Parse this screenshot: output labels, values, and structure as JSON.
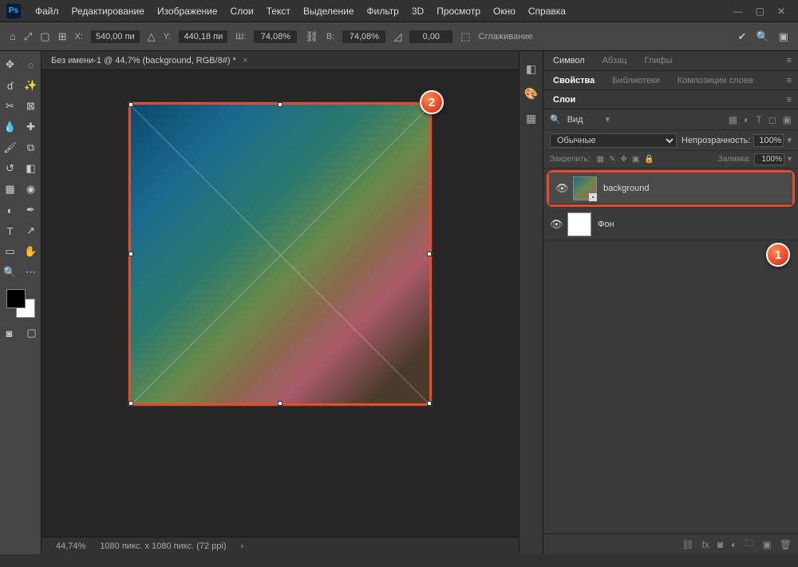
{
  "app": {
    "icon_text": "Ps"
  },
  "menu": [
    "Файл",
    "Редактирование",
    "Изображение",
    "Слои",
    "Текст",
    "Выделение",
    "Фильтр",
    "3D",
    "Просмотр",
    "Окно",
    "Справка"
  ],
  "options": {
    "x_label": "X:",
    "x_value": "540,00 пи",
    "y_label": "Y:",
    "y_value": "440,18 пи",
    "w_label": "Ш:",
    "w_value": "74,08%",
    "h_label": "В:",
    "h_value": "74,08%",
    "angle_value": "0,00",
    "antialias": "Сглаживание"
  },
  "doc_tab": {
    "title": "Без имени-1 @ 44,7% (background, RGB/8#) *"
  },
  "status": {
    "zoom": "44,74%",
    "info": "1080 пикс. x 1080 пикс. (72 ppi)"
  },
  "panels_top": {
    "tabs": [
      "Символ",
      "Абзац",
      "Глифы"
    ]
  },
  "panels_mid": {
    "tabs": [
      "Свойства",
      "Библиотеки",
      "Композиции слоев"
    ]
  },
  "layers": {
    "title": "Слои",
    "filter_label": "Вид",
    "blend_mode": "Обычные",
    "opacity_label": "Непрозрачность:",
    "opacity_value": "100%",
    "lock_label": "Закрепить:",
    "fill_label": "Заливка:",
    "fill_value": "100%",
    "items": [
      {
        "name": "background",
        "selected": true,
        "highlighted": true
      },
      {
        "name": "Фон",
        "selected": false,
        "highlighted": false
      }
    ]
  },
  "callouts": {
    "c1": "1",
    "c2": "2"
  }
}
